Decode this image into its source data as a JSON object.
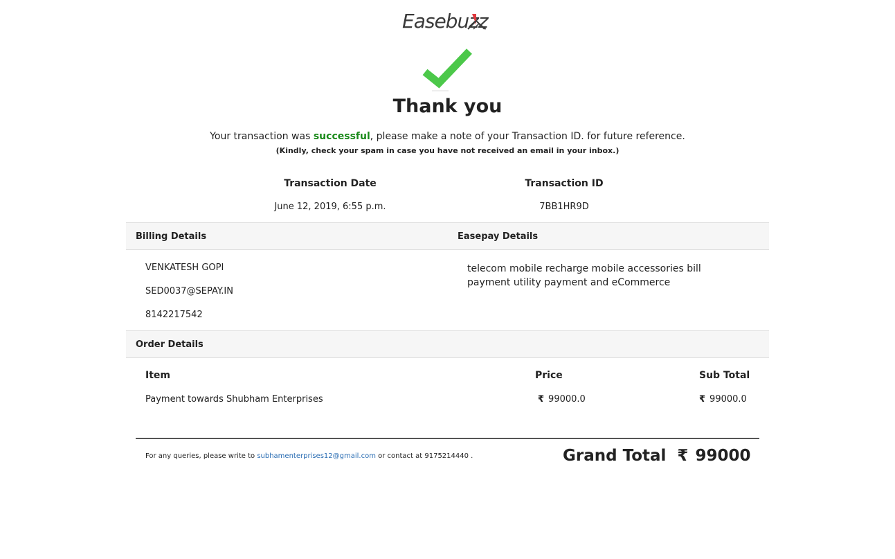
{
  "brand": {
    "logo_text": "Easebuzz"
  },
  "header": {
    "title": "Thank you",
    "message_prefix": "Your transaction was ",
    "message_status": "successful",
    "message_suffix": ", please make a note of your Transaction ID. for future reference.",
    "spam_note": "(Kindly, check your spam in case you have not received an email in your inbox.)"
  },
  "transaction": {
    "date_label": "Transaction Date",
    "date_value": "June 12, 2019, 6:55 p.m.",
    "id_label": "Transaction ID",
    "id_value": "7BB1HR9D"
  },
  "billing": {
    "label": "Billing Details",
    "name": "VENKATESH GOPI",
    "email": "SED0037@SEPAY.IN",
    "phone": "8142217542"
  },
  "easepay": {
    "label": "Easepay Details",
    "description": "telecom mobile recharge mobile accessories bill payment utility payment and eCommerce"
  },
  "order": {
    "label": "Order Details",
    "columns": {
      "item": "Item",
      "price": "Price",
      "subtotal": "Sub Total"
    },
    "rows": [
      {
        "item": "Payment towards Shubham Enterprises",
        "price": "99000.0",
        "subtotal": "99000.0"
      }
    ],
    "currency_symbol": "₹"
  },
  "footer": {
    "query_prefix": "For any queries, please write to ",
    "email": "subhamenterprises12@gmail.com",
    "contact_prefix": " or contact at ",
    "phone": "9175214440",
    "suffix": " ."
  },
  "grand_total": {
    "label": "Grand Total",
    "currency_symbol": "₹",
    "value": "99000"
  },
  "colors": {
    "success": "#1a8a1a",
    "check": "#4cc84a",
    "link": "#2a6db3",
    "logo_red": "#e0393e"
  }
}
